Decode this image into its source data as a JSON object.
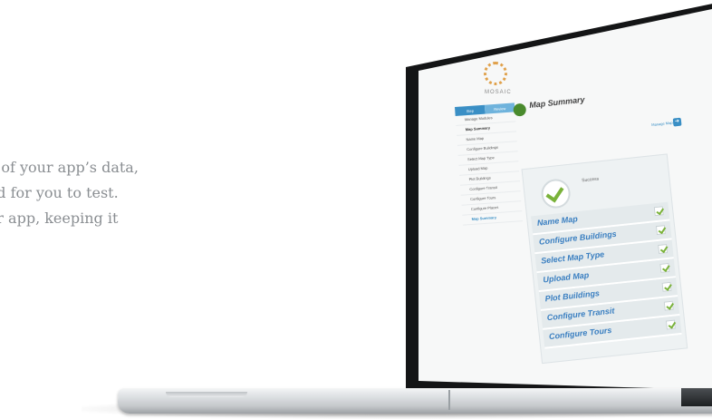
{
  "marketing": {
    "line1": "ll of your app’s data,",
    "line2": "ild for you to test.",
    "line3": "ur app, keeping it"
  },
  "app": {
    "logo_text": "MOSAIC",
    "sidebar": {
      "tabs": [
        "Step",
        "Review"
      ],
      "items": [
        "Manage Modules",
        "Map Summary",
        "Name Map",
        "Configure Buildings",
        "Select Map Type",
        "Upload Map",
        "Plot Buildings",
        "Configure Transit",
        "Configure Tours",
        "Configure Places",
        "Map Summary"
      ]
    },
    "summary": {
      "title": "Map Summary",
      "manage_label": "Manage Maps",
      "success_title": "Success"
    },
    "steps": [
      {
        "label": "Name Map",
        "done": true
      },
      {
        "label": "Configure Buildings",
        "done": true
      },
      {
        "label": "Select Map Type",
        "done": true
      },
      {
        "label": "Upload Map",
        "done": true
      },
      {
        "label": "Plot Buildings",
        "done": true
      },
      {
        "label": "Configure Transit",
        "done": true
      },
      {
        "label": "Configure Tours",
        "done": true
      }
    ],
    "colors": {
      "accent": "#3a7fc1",
      "check": "#7ab23a",
      "tab_active": "#3a8fc5"
    }
  }
}
